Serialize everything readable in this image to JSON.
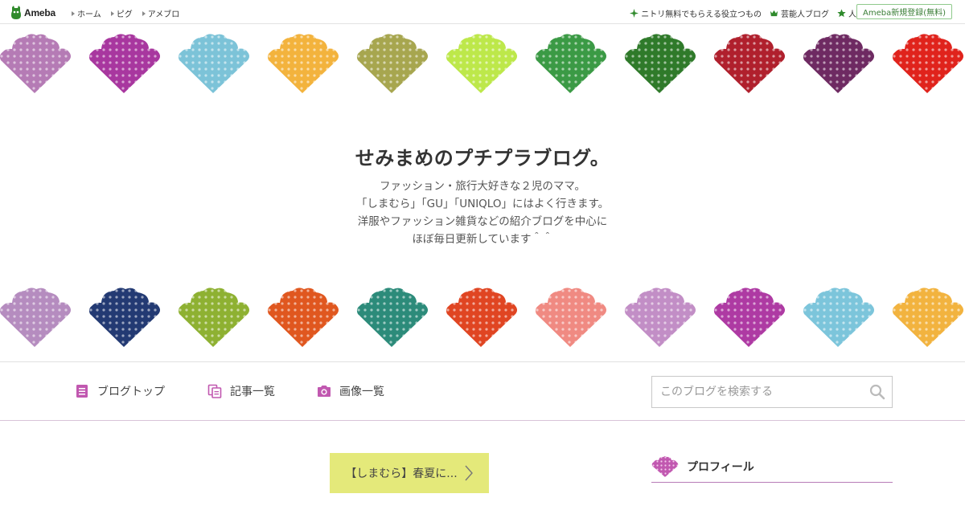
{
  "topbar": {
    "logo_text": "Ameba",
    "nav_left": [
      "ホーム",
      "ピグ",
      "アメブロ"
    ],
    "nav_right": [
      {
        "label": "ニトリ無料でもらえる役立つもの",
        "icon": "sparkle-icon"
      },
      {
        "label": "芸能人ブログ",
        "icon": "crown-icon"
      },
      {
        "label": "人気ブログ",
        "icon": "star-icon"
      }
    ],
    "signup_label": "Ameba新規登録(無料)"
  },
  "header": {
    "title": "せみまめのプチプラブログ。",
    "description": [
      "ファッション・旅行大好きな２児のママ。",
      "「しまむら」「GU」「UNIQLO」にはよく行きます。",
      "洋服やファッション雑貨などの紹介ブログを中心に",
      "ほぼ毎日更新しています＾＾"
    ],
    "pattern_top_colors": [
      "#b57bb5",
      "#a8379f",
      "#7cc3d8",
      "#f3b33d",
      "#a7a64f",
      "#bde84a",
      "#3b9a45",
      "#2f7a2a",
      "#b0202d",
      "#6e2a62",
      "#e0231c"
    ],
    "pattern_bottom_colors": [
      "#b58cbf",
      "#233a73",
      "#8eb132",
      "#e0571f",
      "#2c8b7a",
      "#e04522",
      "#f08a82",
      "#c28ec6",
      "#ae3aa3",
      "#7cc5db",
      "#f2b33f"
    ]
  },
  "navbar": {
    "blog_top": "ブログトップ",
    "entry_list": "記事一覧",
    "image_list": "画像一覧",
    "search_placeholder": "このブログを検索する"
  },
  "content": {
    "entry_button": "【しまむら】春夏に...",
    "profile_title": "プロフィール"
  },
  "colors": {
    "accent": "#c158b0",
    "entry_button_bg": "#e4e97a",
    "ameba_green": "#2f8a2c"
  }
}
